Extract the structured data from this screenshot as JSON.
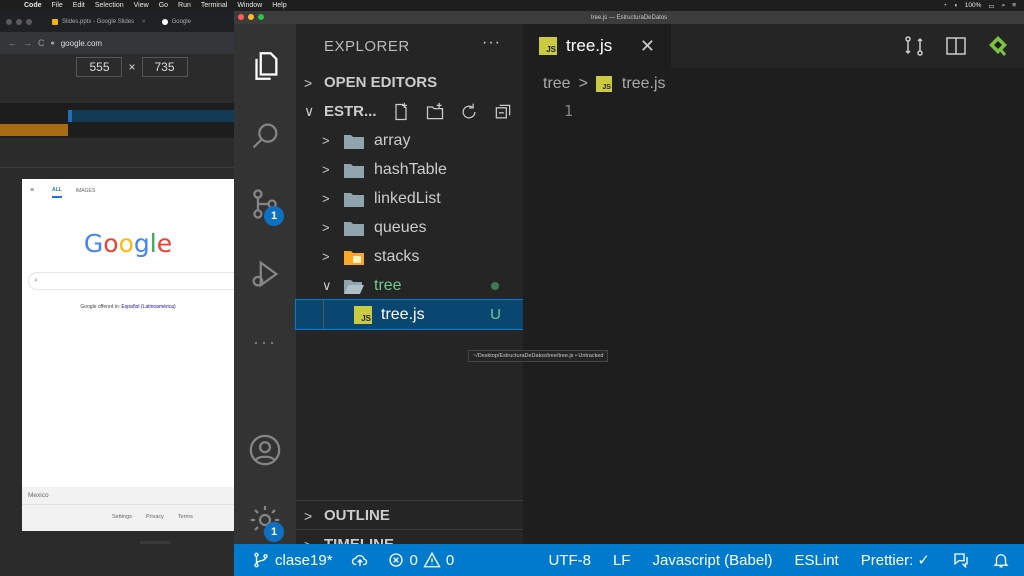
{
  "menubar": {
    "items": [
      "Code",
      "File",
      "Edit",
      "Selection",
      "View",
      "Go",
      "Run",
      "Terminal",
      "Window",
      "Help"
    ],
    "battery": "100%"
  },
  "browser": {
    "tabs": [
      {
        "label": "Slides.pptx - Google Slides"
      },
      {
        "label": "Google"
      }
    ],
    "url": "google.com",
    "viewport_width": "555",
    "viewport_sep": "×",
    "viewport_height": "735",
    "page": {
      "nav_all": "ALL",
      "nav_images": "IMAGES",
      "offered_prefix": "Google offered in:",
      "offered_lang": "Español (Latinoamérica)",
      "country": "Mexico",
      "footer_links": [
        "Settings",
        "Privacy",
        "Terms"
      ]
    }
  },
  "vscode": {
    "window_title": "tree.js — EstructuraDeDatos",
    "explorer": {
      "title": "EXPLORER",
      "more": "···",
      "open_editors": "OPEN EDITORS",
      "folder_root": "ESTR...",
      "items": [
        {
          "label": "array"
        },
        {
          "label": "hashTable"
        },
        {
          "label": "linkedList"
        },
        {
          "label": "queues"
        },
        {
          "label": "stacks"
        },
        {
          "label": "tree"
        }
      ],
      "file": {
        "label": "tree.js",
        "status": "U",
        "icon": "JS"
      },
      "tooltip": "~/Desktop/EstructuraDeDatos/tree/tree.js • Untracked",
      "outline": "OUTLINE",
      "timeline": "TIMELINE"
    },
    "activity": {
      "scm_badge": "1",
      "settings_badge": "1"
    },
    "editor": {
      "tab_label": "tree.js",
      "tab_icon": "JS",
      "close": "✕",
      "breadcrumb_folder": "tree",
      "breadcrumb_sep": ">",
      "breadcrumb_file": "tree.js",
      "line_numbers": [
        "1"
      ]
    },
    "status": {
      "branch": "clase19*",
      "errors": "0",
      "warnings": "0",
      "encoding": "UTF-8",
      "eol": "LF",
      "language": "Javascript (Babel)",
      "eslint": "ESLint",
      "prettier": "Prettier: ✓"
    }
  },
  "colors": {
    "accent_blue": "#007acc",
    "js_yellow": "#cbcb41",
    "git_green": "#73c991"
  }
}
